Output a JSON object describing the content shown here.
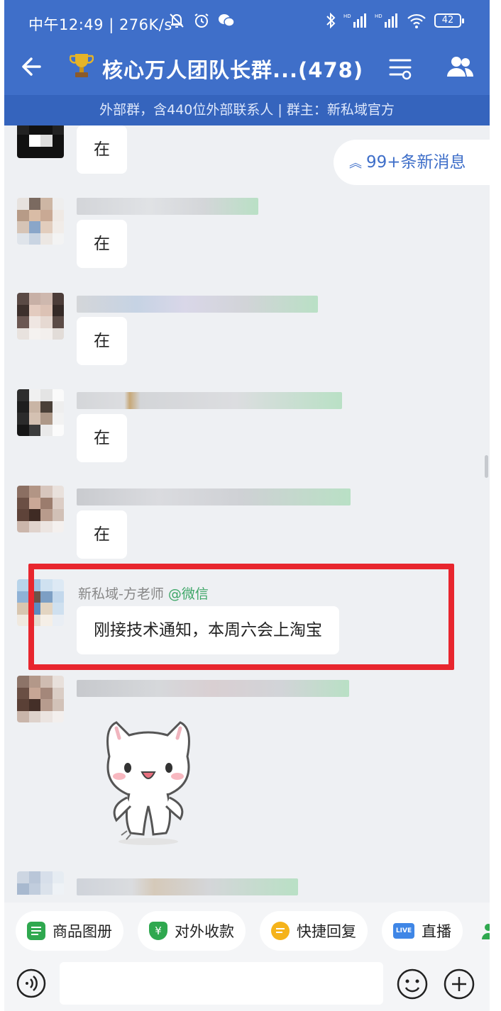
{
  "status_bar": {
    "time": "中午12:49 | 276K/s",
    "battery": "42"
  },
  "header": {
    "title": "核心万人团队长群...(478)",
    "subtitle": "外部群，含440位外部联系人 | 群主：新私域官方"
  },
  "new_messages": "99+条新消息",
  "messages": [
    {
      "text": "在"
    },
    {
      "text": "在"
    },
    {
      "text": "在"
    },
    {
      "text": "在"
    },
    {
      "text": "在"
    },
    {
      "sender": "新私域-方老师",
      "sender_tag": "@微信",
      "text": "刚接技术通知，本周六会上淘宝"
    }
  ],
  "toolbar": {
    "items": [
      {
        "label": "商品图册",
        "color": "#2fa84f"
      },
      {
        "label": "对外收款",
        "color": "#2fa84f"
      },
      {
        "label": "快捷回复",
        "color": "#f5b31b"
      },
      {
        "label": "直播",
        "color": "#3f86e6",
        "badge": "LIVE"
      }
    ]
  },
  "colors": {
    "header_bg": "#3f6fc9",
    "highlight_box": "#e8262e",
    "wechat_tag": "#3da667"
  }
}
